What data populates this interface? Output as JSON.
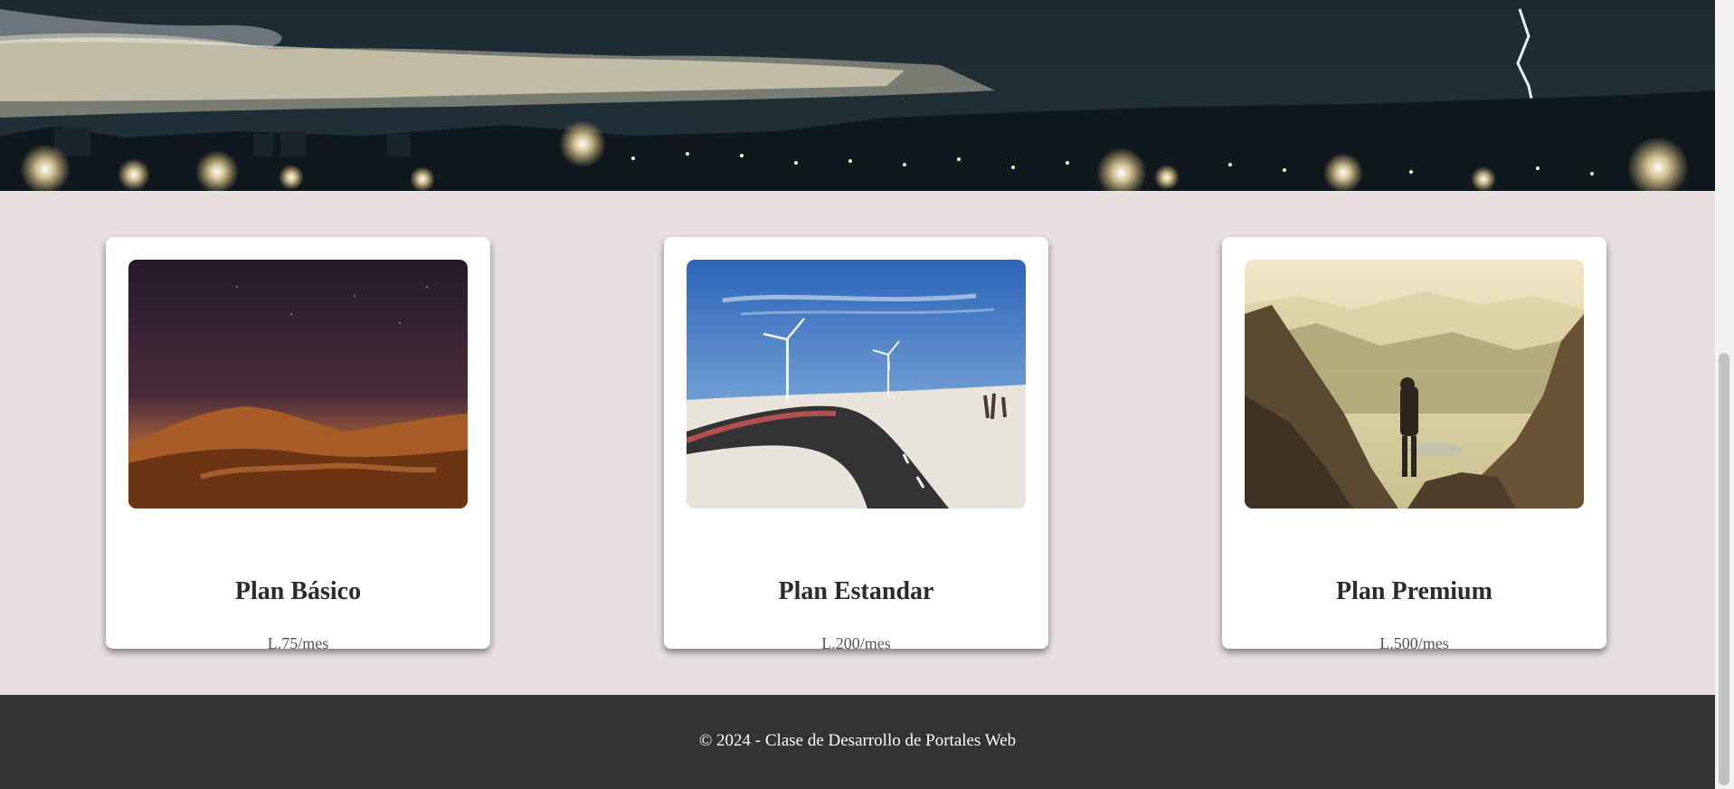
{
  "hero": {
    "image_icon": "night-city-lightning-image"
  },
  "plans": [
    {
      "title": "Plan Básico",
      "price": "L.75/mes",
      "image_icon": "desert-night-image"
    },
    {
      "title": "Plan Estandar",
      "price": "L.200/mes",
      "image_icon": "road-wind-turbines-image"
    },
    {
      "title": "Plan Premium",
      "price": "L.500/mes",
      "image_icon": "mountain-hiker-image"
    }
  ],
  "footer": {
    "text": "© 2024 - Clase de Desarrollo de Portales Web"
  },
  "colors": {
    "page_background": "#e7dfe0",
    "card_background": "#ffffff",
    "footer_background": "#333333",
    "footer_text": "#ffffff",
    "title_text": "#2b2b2b",
    "price_text": "#555555"
  },
  "scrollbar": {
    "position": 0.45
  }
}
